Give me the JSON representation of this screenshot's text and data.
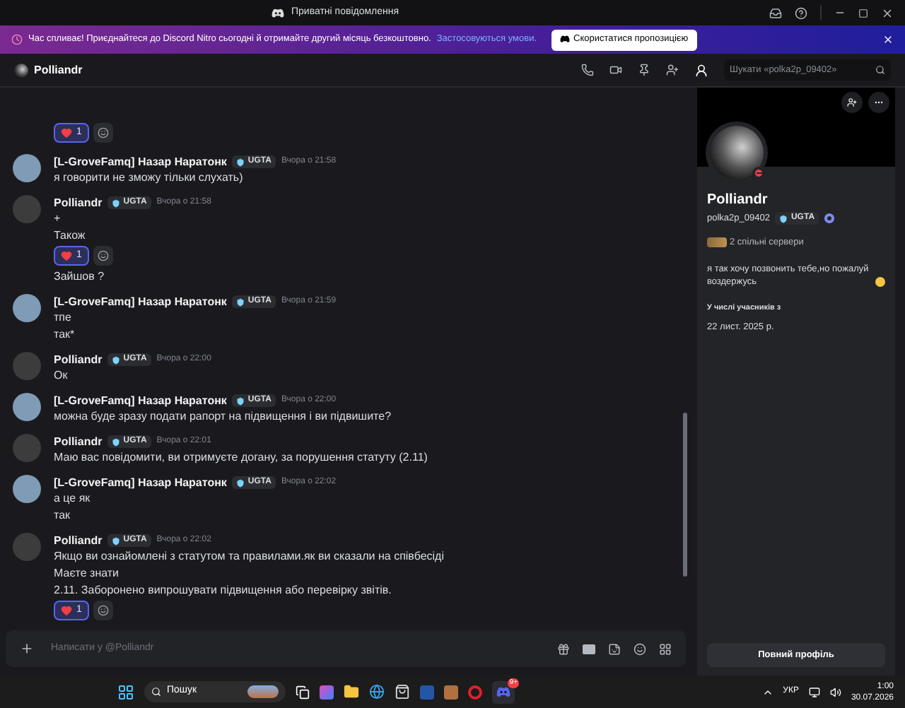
{
  "title_bar": {
    "title": "Приватні повідомлення"
  },
  "promo_banner": {
    "text": "Час спливає! Приєднайтеся до Discord Nitro сьогодні й отримайте другий місяць безкоштовно.",
    "link": "Застосовуються умови.",
    "button": "Скористатися пропозицією"
  },
  "channel_header": {
    "name": "Polliandr",
    "search_placeholder": "Шукати «polka2p_09402»"
  },
  "messages": [
    {
      "kind": "continuation",
      "items": [
        {
          "kind": "reaction",
          "count": "1",
          "selected": true
        }
      ]
    },
    {
      "kind": "group",
      "color": "#7f9bb5",
      "author": "[L-GroveFamq] Назар Наратонк",
      "tag": "UGTA",
      "time": "Вчора о 21:58",
      "items": [
        {
          "kind": "text",
          "text": "я говорити не зможу тільки слухать)"
        }
      ]
    },
    {
      "kind": "group",
      "color": "#3c3c3c",
      "author": "Polliandr",
      "tag": "UGTA",
      "time": "Вчора о 21:58",
      "items": [
        {
          "kind": "text",
          "text": "+"
        },
        {
          "kind": "text",
          "text": "Також"
        },
        {
          "kind": "reaction",
          "count": "1",
          "selected": true
        },
        {
          "kind": "text",
          "text": "Зайшов ?"
        }
      ]
    },
    {
      "kind": "group",
      "color": "#7f9bb5",
      "author": "[L-GroveFamq] Назар Наратонк",
      "tag": "UGTA",
      "time": "Вчора о 21:59",
      "items": [
        {
          "kind": "text",
          "text": "тпе"
        },
        {
          "kind": "text",
          "text": "так*"
        }
      ]
    },
    {
      "kind": "group",
      "color": "#3c3c3c",
      "author": "Polliandr",
      "tag": "UGTA",
      "time": "Вчора о 22:00",
      "items": [
        {
          "kind": "text",
          "text": "Ок"
        }
      ]
    },
    {
      "kind": "group",
      "color": "#7f9bb5",
      "author": "[L-GroveFamq] Назар Наратонк",
      "tag": "UGTA",
      "time": "Вчора о 22:00",
      "items": [
        {
          "kind": "text",
          "text": "можна буде зразу подати рапорт на підвищення і ви підвишите?"
        }
      ]
    },
    {
      "kind": "group",
      "color": "#3c3c3c",
      "author": "Polliandr",
      "tag": "UGTA",
      "time": "Вчора о 22:01",
      "items": [
        {
          "kind": "text",
          "text": "Маю вас повідомити, ви отримуєте догану, за порушення статуту (2.11)"
        }
      ]
    },
    {
      "kind": "group",
      "color": "#7f9bb5",
      "author": "[L-GroveFamq] Назар Наратонк",
      "tag": "UGTA",
      "time": "Вчора о 22:02",
      "items": [
        {
          "kind": "text",
          "text": "а це як"
        },
        {
          "kind": "text",
          "text": "так"
        }
      ]
    },
    {
      "kind": "group",
      "color": "#3c3c3c",
      "author": "Polliandr",
      "tag": "UGTA",
      "time": "Вчора о 22:02",
      "items": [
        {
          "kind": "text",
          "text": "Якщо ви ознайомлені з статутом та правилами.як ви сказали на співбесіді"
        },
        {
          "kind": "text",
          "text": "Маєте знати"
        },
        {
          "kind": "text",
          "text": "2.11. Заборонено випрошувати підвищення або перевірку звітів."
        },
        {
          "kind": "reaction",
          "count": "1",
          "selected": true
        }
      ]
    }
  ],
  "composer": {
    "placeholder": "Написати у @Polliandr"
  },
  "profile": {
    "name": "Polliandr",
    "do_not_disturb": true,
    "username": "polka2p_09402",
    "tag": "UGTA",
    "mutual_servers": "2 спільні сервери",
    "bio": "я так хочу позвонить тебе,но пожалуй воздержусь",
    "member_since_label": "У числі учасників з",
    "member_since": "22 лист. 2025 р.",
    "button": "Повний профіль"
  },
  "taskbar": {
    "search": "Пошук",
    "notification_badge": "9+",
    "language": "УКР",
    "time": "1:00",
    "date": "30.07.2026"
  }
}
